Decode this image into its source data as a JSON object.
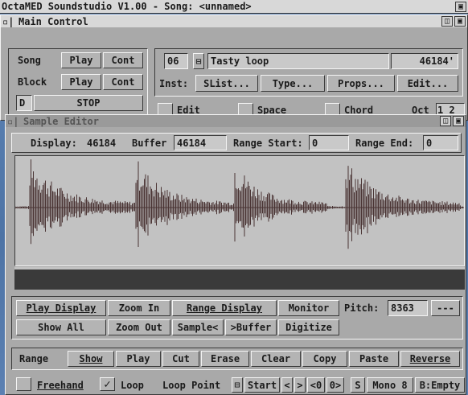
{
  "screen_title": "OctaMED Soundstudio V1.00 - Song: <unnamed>",
  "main_control": {
    "title": "Main Control",
    "song_label": "Song",
    "block_label": "Block",
    "play": "Play",
    "cont": "Cont",
    "d_label": "D",
    "stop": "STOP",
    "sample_number": "06",
    "sample_name": "Tasty loop",
    "sample_length": "46184'",
    "inst_label": "Inst:",
    "slist": "SList...",
    "type": "Type...",
    "props": "Props...",
    "edit_btn": "Edit...",
    "edit_chk": "Edit",
    "space_chk": "Space",
    "chord_chk": "Chord",
    "oct_label": "Oct",
    "oct_value": "1 2"
  },
  "sample_editor": {
    "title": "Sample Editor",
    "display_label": "Display:",
    "display_value": "46184",
    "buffer_label": "Buffer",
    "buffer_value": "46184",
    "range_start_label": "Range Start:",
    "range_start_value": "0",
    "range_end_label": "Range End:",
    "range_end_value": "0",
    "row1": [
      "Play Display",
      "Zoom In",
      "Range Display",
      "Monitor"
    ],
    "pitch_label": "Pitch:",
    "pitch_value": "8363",
    "pitch_btn": "---",
    "row2": [
      "Show All",
      "Zoom Out",
      "Sample<",
      ">Buffer",
      "Digitize"
    ],
    "row3": [
      "Range",
      "Show",
      "Play",
      "Cut",
      "Erase",
      "Clear",
      "Copy",
      "Paste",
      "Reverse"
    ],
    "freehand": "Freehand",
    "loop": "Loop",
    "loop_point": "Loop Point",
    "start": "Start",
    "nav": [
      "<",
      ">",
      "<0",
      "0>"
    ],
    "s_label": "S",
    "mono": "Mono 8",
    "b_empty": "B:Empty"
  },
  "colors": {
    "waveform": "#4a3434",
    "waveform_bg": "#c2c2c2",
    "desktop": "#5f86b8",
    "panel": "#a9a9a9"
  }
}
